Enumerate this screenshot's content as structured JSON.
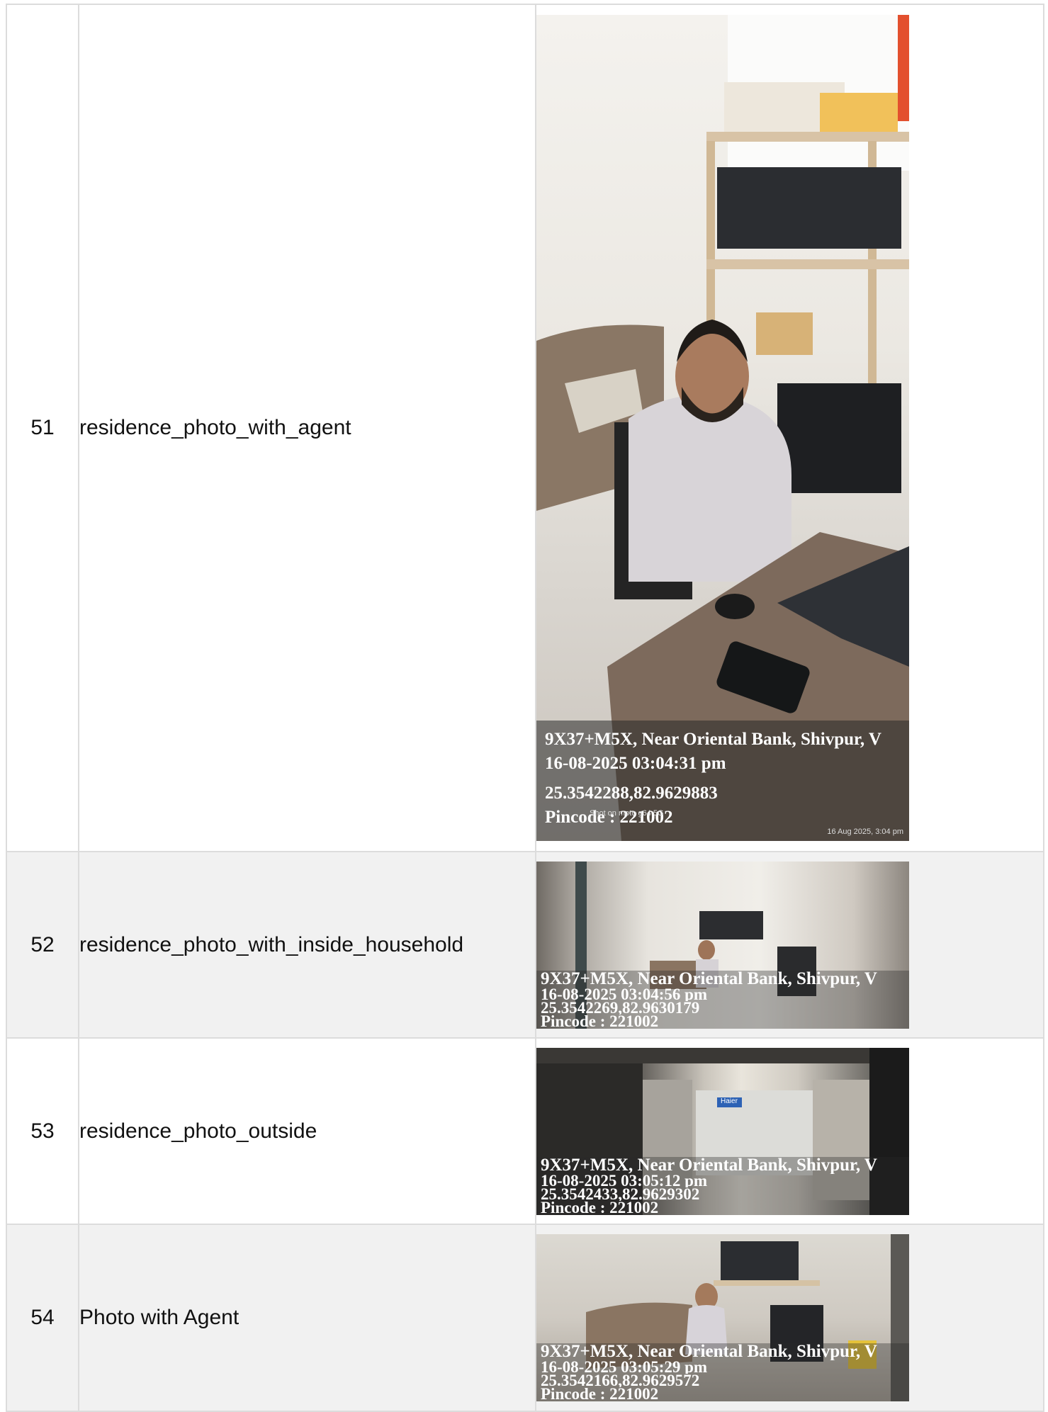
{
  "rows": [
    {
      "num": "51",
      "label": "residence_photo_with_agent",
      "overlay": {
        "address": "9X37+M5X, Near Oriental Bank, Shivpur, V",
        "datetime": "16-08-2025 03:04:31 pm",
        "coords": "25.3542288,82.9629883",
        "pincode": "Pincode : 221002",
        "camera": "Shot on moto g64 5G",
        "stamp": "16 Aug 2025, 3:04 pm"
      }
    },
    {
      "num": "52",
      "label": "residence_photo_with_inside_household",
      "overlay": {
        "address": "9X37+M5X, Near Oriental Bank, Shivpur, V",
        "datetime": "16-08-2025 03:04:56 pm",
        "coords": "25.3542269,82.9630179",
        "pincode": "Pincode : 221002"
      }
    },
    {
      "num": "53",
      "label": "residence_photo_outside",
      "overlay": {
        "address": "9X37+M5X, Near Oriental Bank, Shivpur, V",
        "datetime": "16-08-2025 03:05:12 pm",
        "coords": "25.3542433,82.9629302",
        "pincode": "Pincode : 221002",
        "sign": "Haier"
      }
    },
    {
      "num": "54",
      "label": "Photo with Agent",
      "overlay": {
        "address": "9X37+M5X, Near Oriental Bank, Shivpur, V",
        "datetime": "16-08-2025 03:05:29 pm",
        "coords": "25.3542166,82.9629572",
        "pincode": "Pincode : 221002"
      }
    }
  ]
}
